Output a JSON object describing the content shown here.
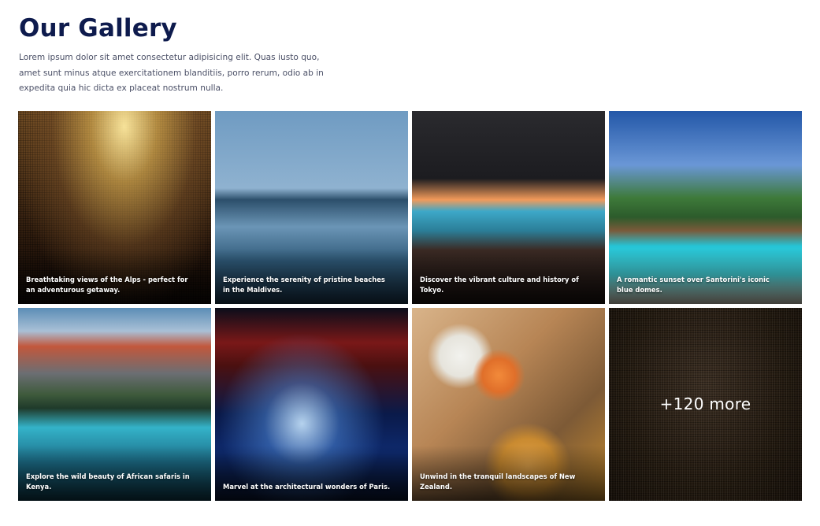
{
  "header": {
    "title": "Our Gallery",
    "description": "Lorem ipsum dolor sit amet consectetur adipisicing elit. Quas iusto quo, amet sunt minus atque exercitationem blanditiis, porro rerum, odio ab in expedita quia hic dicta ex placeat nostrum nulla."
  },
  "gallery": {
    "items": [
      {
        "caption": "Breathtaking views of the Alps - perfect for an adventurous getaway."
      },
      {
        "caption": "Experience the serenity of pristine beaches in the Maldives."
      },
      {
        "caption": "Discover the vibrant culture and history of Tokyo."
      },
      {
        "caption": "A romantic sunset over Santorini's iconic blue domes."
      },
      {
        "caption": "Explore the wild beauty of African safaris in Kenya."
      },
      {
        "caption": "Marvel at the architectural wonders of Paris."
      },
      {
        "caption": "Unwind in the tranquil landscapes of New Zealand."
      }
    ],
    "more_label": "+120 more"
  }
}
